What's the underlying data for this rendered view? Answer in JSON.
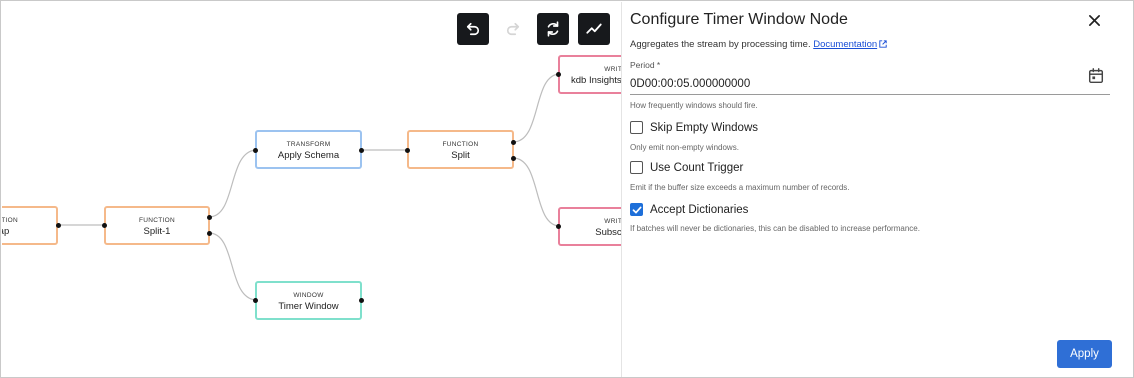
{
  "toolbar": {
    "undo_icon": "undo-icon",
    "redo_icon": "redo-icon",
    "refresh_icon": "refresh-icon",
    "chart_icon": "line-chart-icon"
  },
  "pipeline": {
    "nodes": [
      {
        "id": "map",
        "type": "FUNCTION",
        "name": "Map"
      },
      {
        "id": "split1",
        "type": "FUNCTION",
        "name": "Split-1"
      },
      {
        "id": "applyschema",
        "type": "TRANSFORM",
        "name": "Apply Schema"
      },
      {
        "id": "split",
        "type": "FUNCTION",
        "name": "Split"
      },
      {
        "id": "timerwindow",
        "type": "WINDOW",
        "name": "Timer Window"
      },
      {
        "id": "writer1",
        "type": "WRITER",
        "name": "kdb Insights Database"
      },
      {
        "id": "writer2",
        "type": "WRITER",
        "name": "Subscriber"
      }
    ]
  },
  "panel": {
    "title": "Configure Timer Window Node",
    "description": "Aggregates the stream by processing time.",
    "doc_link": "Documentation",
    "period": {
      "label": "Period *",
      "value": "0D00:00:05.000000000",
      "helper": "How frequently windows should fire."
    },
    "options": [
      {
        "label": "Skip Empty Windows",
        "checked": false,
        "helper": "Only emit non-empty windows."
      },
      {
        "label": "Use Count Trigger",
        "checked": false,
        "helper": "Emit if the buffer size exceeds a maximum number of records."
      },
      {
        "label": "Accept Dictionaries",
        "checked": true,
        "helper": "If batches will never be dictionaries, this can be disabled to increase performance."
      }
    ],
    "apply_label": "Apply"
  },
  "colors": {
    "function": "#f5b98a",
    "transform": "#9cc3f0",
    "window": "#7fe0cc",
    "writer": "#e9809b",
    "accent": "#2f6fd6"
  }
}
